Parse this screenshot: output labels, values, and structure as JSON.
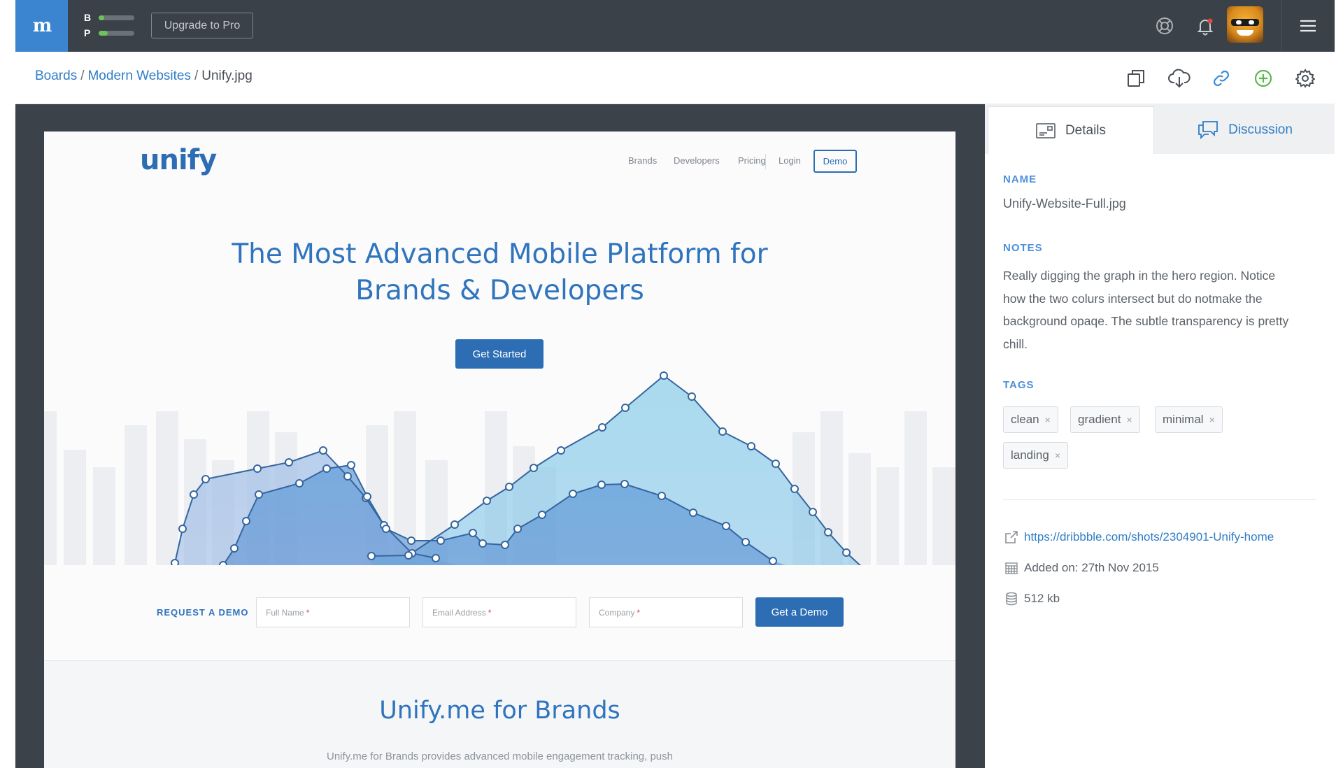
{
  "app": {
    "logo": "m",
    "meter": [
      {
        "letter": "B",
        "fill": 0.15
      },
      {
        "letter": "P",
        "fill": 0.25
      }
    ],
    "upgrade_label": "Upgrade to Pro",
    "icons": {
      "help": "lifebuoy-icon",
      "notifications": "bell-icon",
      "menu": "hamburger-menu-icon"
    }
  },
  "breadcrumb": {
    "items": [
      "Boards",
      "Modern Websites"
    ],
    "current": "Unify.jpg",
    "separator": "/"
  },
  "toolbar_icons": [
    "copy-icon",
    "download-cloud-icon",
    "link-icon",
    "add-circle-icon",
    "settings-gear-icon"
  ],
  "colors": {
    "accent": "#2f7dc6",
    "brand_blue": "#2c6db3",
    "add_green": "#58b94a",
    "topbar": "#3a4148"
  },
  "preview": {
    "logo": "unify",
    "nav": [
      "Brands",
      "Developers",
      "Pricing",
      "Login"
    ],
    "nav_cta": "Demo",
    "headline_line1": "The Most Advanced Mobile Platform for",
    "headline_line2": "Brands & Developers",
    "cta": "Get Started",
    "request_label": "REQUEST A DEMO",
    "fields": [
      {
        "placeholder": "Full Name",
        "required": "*"
      },
      {
        "placeholder": "Email Address",
        "required": "*"
      },
      {
        "placeholder": "Company",
        "required": "*"
      }
    ],
    "submit": "Get a Demo",
    "section_title": "Unify.me for Brands",
    "section_text": "Unify.me for Brands provides advanced mobile engagement tracking, push"
  },
  "panel": {
    "tabs": [
      {
        "label": "Details",
        "active": true
      },
      {
        "label": "Discussion",
        "active": false
      }
    ],
    "name_label": "NAME",
    "name_value": "Unify-Website-Full.jpg",
    "notes_label": "NOTES",
    "notes_text": "Really digging the graph in the hero region. Notice how the two colurs intersect but do notmake the background opaqe. The subtle transparency is pretty chill.",
    "tags_label": "TAGS",
    "tags": [
      "clean",
      "gradient",
      "minimal",
      "landing"
    ],
    "tag_remove": "×",
    "url": "https://dribbble.com/shots/2304901-Unify-home",
    "added_on": "Added on: 27th Nov 2015",
    "size": "512 kb"
  }
}
